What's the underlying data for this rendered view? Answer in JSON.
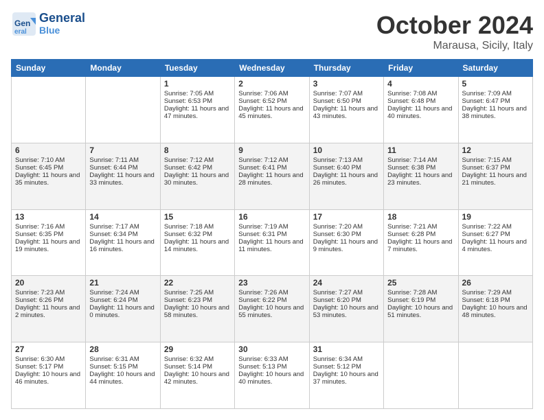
{
  "header": {
    "logo_main": "General",
    "logo_sub": "Blue",
    "month": "October 2024",
    "location": "Marausa, Sicily, Italy"
  },
  "weekdays": [
    "Sunday",
    "Monday",
    "Tuesday",
    "Wednesday",
    "Thursday",
    "Friday",
    "Saturday"
  ],
  "rows": [
    [
      {
        "day": "",
        "info": ""
      },
      {
        "day": "",
        "info": ""
      },
      {
        "day": "1",
        "info": "Sunrise: 7:05 AM\nSunset: 6:53 PM\nDaylight: 11 hours and 47 minutes."
      },
      {
        "day": "2",
        "info": "Sunrise: 7:06 AM\nSunset: 6:52 PM\nDaylight: 11 hours and 45 minutes."
      },
      {
        "day": "3",
        "info": "Sunrise: 7:07 AM\nSunset: 6:50 PM\nDaylight: 11 hours and 43 minutes."
      },
      {
        "day": "4",
        "info": "Sunrise: 7:08 AM\nSunset: 6:48 PM\nDaylight: 11 hours and 40 minutes."
      },
      {
        "day": "5",
        "info": "Sunrise: 7:09 AM\nSunset: 6:47 PM\nDaylight: 11 hours and 38 minutes."
      }
    ],
    [
      {
        "day": "6",
        "info": "Sunrise: 7:10 AM\nSunset: 6:45 PM\nDaylight: 11 hours and 35 minutes."
      },
      {
        "day": "7",
        "info": "Sunrise: 7:11 AM\nSunset: 6:44 PM\nDaylight: 11 hours and 33 minutes."
      },
      {
        "day": "8",
        "info": "Sunrise: 7:12 AM\nSunset: 6:42 PM\nDaylight: 11 hours and 30 minutes."
      },
      {
        "day": "9",
        "info": "Sunrise: 7:12 AM\nSunset: 6:41 PM\nDaylight: 11 hours and 28 minutes."
      },
      {
        "day": "10",
        "info": "Sunrise: 7:13 AM\nSunset: 6:40 PM\nDaylight: 11 hours and 26 minutes."
      },
      {
        "day": "11",
        "info": "Sunrise: 7:14 AM\nSunset: 6:38 PM\nDaylight: 11 hours and 23 minutes."
      },
      {
        "day": "12",
        "info": "Sunrise: 7:15 AM\nSunset: 6:37 PM\nDaylight: 11 hours and 21 minutes."
      }
    ],
    [
      {
        "day": "13",
        "info": "Sunrise: 7:16 AM\nSunset: 6:35 PM\nDaylight: 11 hours and 19 minutes."
      },
      {
        "day": "14",
        "info": "Sunrise: 7:17 AM\nSunset: 6:34 PM\nDaylight: 11 hours and 16 minutes."
      },
      {
        "day": "15",
        "info": "Sunrise: 7:18 AM\nSunset: 6:32 PM\nDaylight: 11 hours and 14 minutes."
      },
      {
        "day": "16",
        "info": "Sunrise: 7:19 AM\nSunset: 6:31 PM\nDaylight: 11 hours and 11 minutes."
      },
      {
        "day": "17",
        "info": "Sunrise: 7:20 AM\nSunset: 6:30 PM\nDaylight: 11 hours and 9 minutes."
      },
      {
        "day": "18",
        "info": "Sunrise: 7:21 AM\nSunset: 6:28 PM\nDaylight: 11 hours and 7 minutes."
      },
      {
        "day": "19",
        "info": "Sunrise: 7:22 AM\nSunset: 6:27 PM\nDaylight: 11 hours and 4 minutes."
      }
    ],
    [
      {
        "day": "20",
        "info": "Sunrise: 7:23 AM\nSunset: 6:26 PM\nDaylight: 11 hours and 2 minutes."
      },
      {
        "day": "21",
        "info": "Sunrise: 7:24 AM\nSunset: 6:24 PM\nDaylight: 11 hours and 0 minutes."
      },
      {
        "day": "22",
        "info": "Sunrise: 7:25 AM\nSunset: 6:23 PM\nDaylight: 10 hours and 58 minutes."
      },
      {
        "day": "23",
        "info": "Sunrise: 7:26 AM\nSunset: 6:22 PM\nDaylight: 10 hours and 55 minutes."
      },
      {
        "day": "24",
        "info": "Sunrise: 7:27 AM\nSunset: 6:20 PM\nDaylight: 10 hours and 53 minutes."
      },
      {
        "day": "25",
        "info": "Sunrise: 7:28 AM\nSunset: 6:19 PM\nDaylight: 10 hours and 51 minutes."
      },
      {
        "day": "26",
        "info": "Sunrise: 7:29 AM\nSunset: 6:18 PM\nDaylight: 10 hours and 48 minutes."
      }
    ],
    [
      {
        "day": "27",
        "info": "Sunrise: 6:30 AM\nSunset: 5:17 PM\nDaylight: 10 hours and 46 minutes."
      },
      {
        "day": "28",
        "info": "Sunrise: 6:31 AM\nSunset: 5:15 PM\nDaylight: 10 hours and 44 minutes."
      },
      {
        "day": "29",
        "info": "Sunrise: 6:32 AM\nSunset: 5:14 PM\nDaylight: 10 hours and 42 minutes."
      },
      {
        "day": "30",
        "info": "Sunrise: 6:33 AM\nSunset: 5:13 PM\nDaylight: 10 hours and 40 minutes."
      },
      {
        "day": "31",
        "info": "Sunrise: 6:34 AM\nSunset: 5:12 PM\nDaylight: 10 hours and 37 minutes."
      },
      {
        "day": "",
        "info": ""
      },
      {
        "day": "",
        "info": ""
      }
    ]
  ]
}
